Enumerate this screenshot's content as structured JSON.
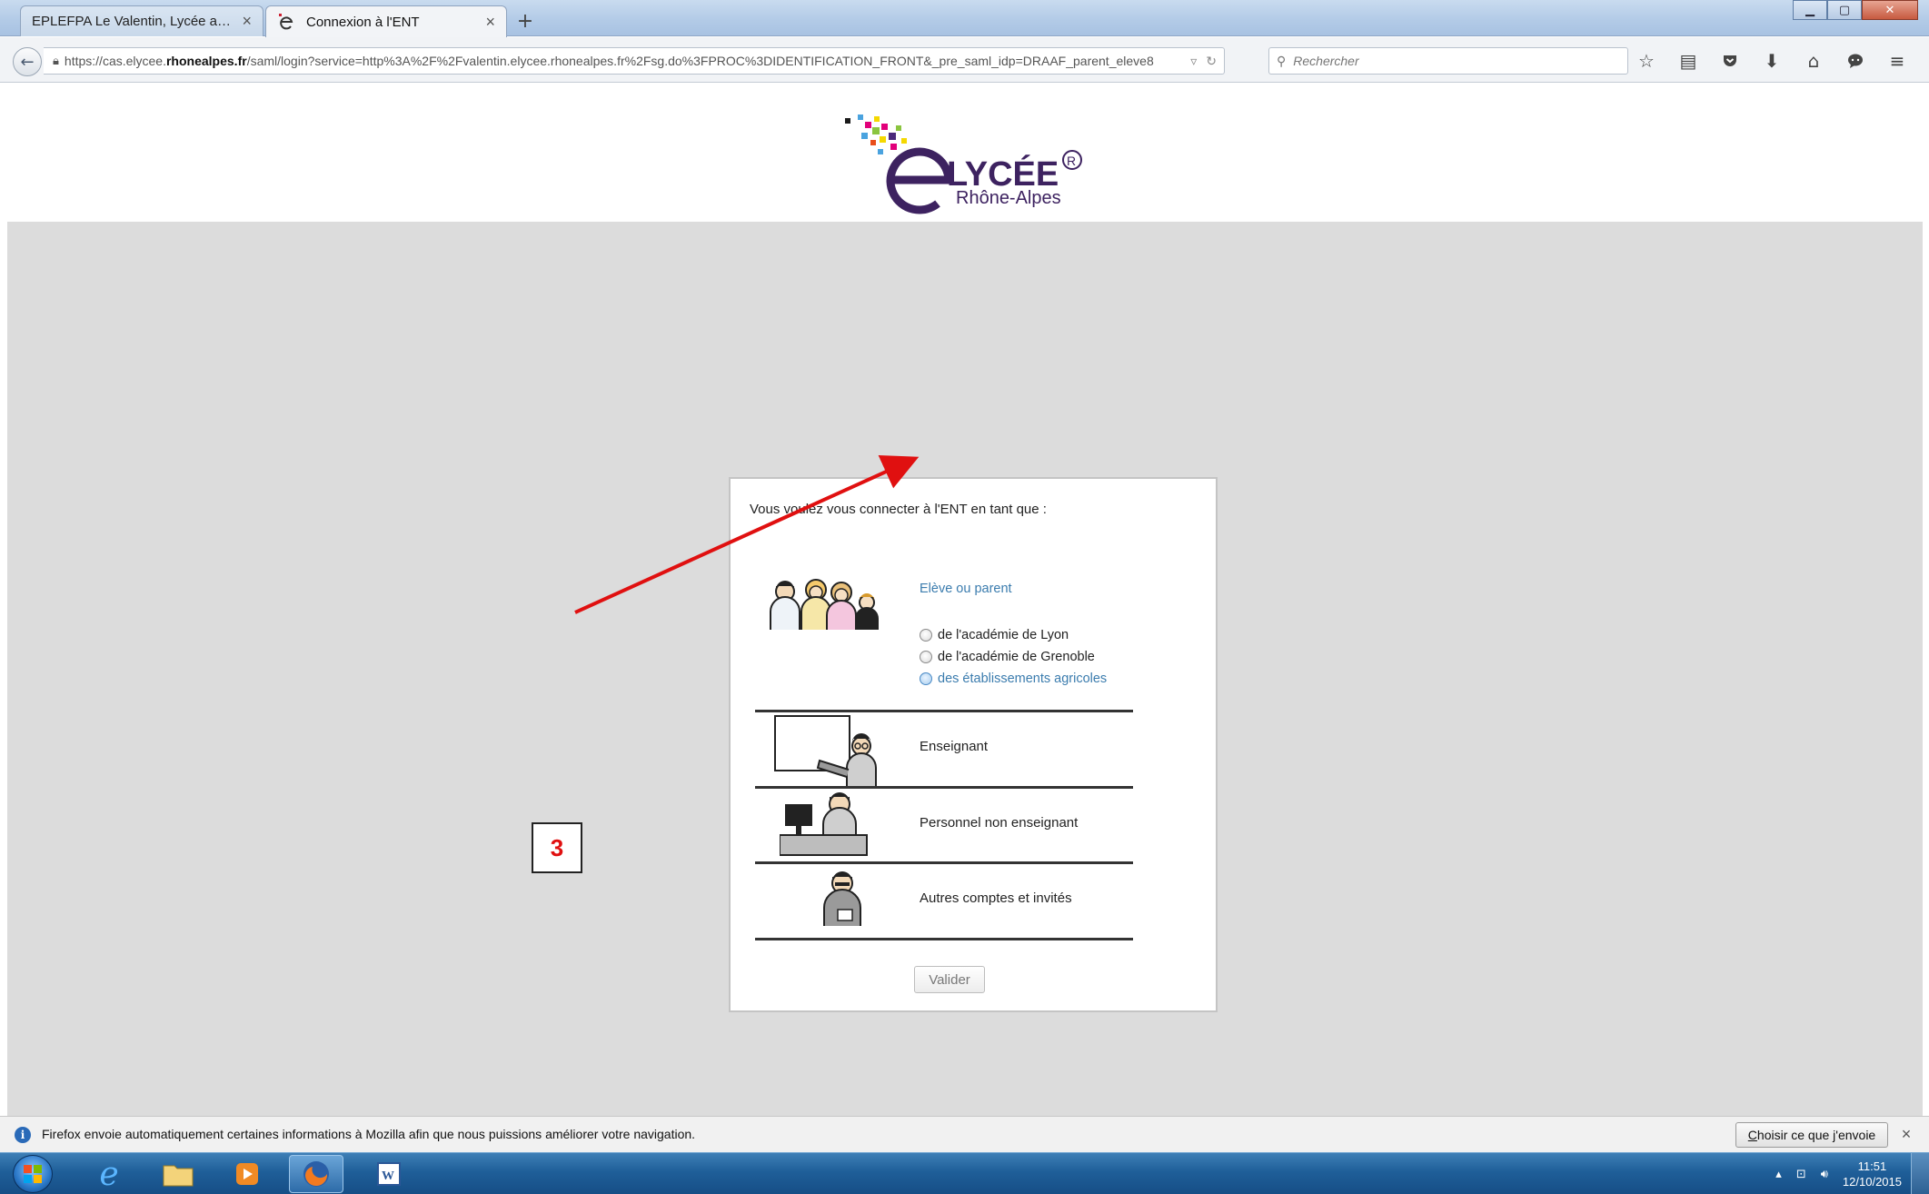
{
  "browser": {
    "tabs": [
      {
        "label": "EPLEFPA Le Valentin, Lycée agr...",
        "active": false
      },
      {
        "label": "Connexion à l'ENT",
        "active": true
      }
    ],
    "new_tab_label": "+",
    "url_prefix": "https://cas.elycee.",
    "url_domain": "rhonealpes.fr",
    "url_rest": "/saml/login?service=http%3A%2F%2Fvalentin.elycee.rhonealpes.fr%2Fsg.do%3FPROC%3DIDENTIFICATION_FRONT&_pre_saml_idp=DRAAF_parent_eleve8",
    "search_placeholder": "Rechercher",
    "toolbar_icons": [
      "star-icon",
      "reading-list-icon",
      "pocket-icon",
      "download-icon",
      "home-icon",
      "chat-icon",
      "menu-icon"
    ]
  },
  "page": {
    "logo": {
      "main": "LYCÉE",
      "sub": "Rhône-Alpes"
    },
    "prompt": "Vous voulez vous connecter à l'ENT en tant que :",
    "eleve": {
      "title": "Elève ou parent",
      "options": [
        {
          "label": "de l'académie de Lyon",
          "selected": false
        },
        {
          "label": "de l'académie de Grenoble",
          "selected": false
        },
        {
          "label": "des établissements agricoles",
          "selected": false,
          "hovered": true
        }
      ]
    },
    "roles": [
      {
        "label": "Enseignant"
      },
      {
        "label": "Personnel non enseignant"
      },
      {
        "label": "Autres comptes et invités"
      }
    ],
    "validate_label": "Valider",
    "annotation": "3"
  },
  "notification": {
    "text": "Firefox envoie automatiquement certaines informations à Mozilla afin que nous puissions améliorer votre navigation.",
    "button_label_first": "C",
    "button_label_rest": "hoisir ce que j'envoie",
    "close_label": "×"
  },
  "taskbar": {
    "time": "11:51",
    "date": "12/10/2015"
  },
  "colors": {
    "link_blue": "#3b7cae",
    "annotation_red": "#e01010",
    "content_gray": "#dcdcdc"
  }
}
